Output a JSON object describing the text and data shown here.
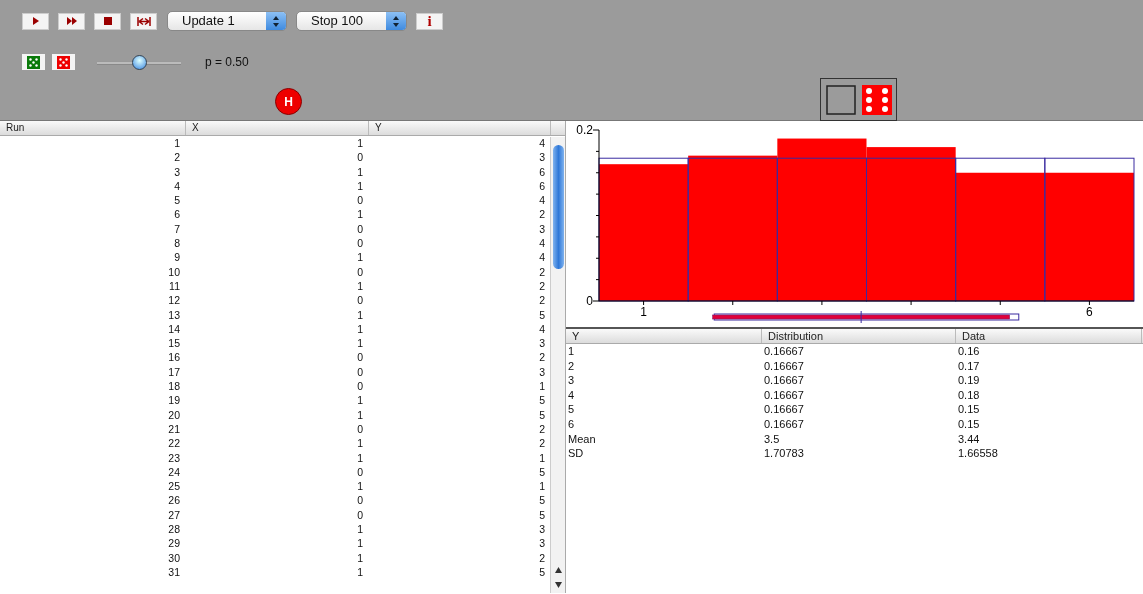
{
  "toolbar": {
    "update_select": {
      "value": "Update 1"
    },
    "stop_select": {
      "value": "Stop 100"
    },
    "info_button": "i"
  },
  "parameter": {
    "label": "p = 0.50",
    "level": 0.5
  },
  "result_badge": "H",
  "runs_table": {
    "columns": [
      "Run",
      "X",
      "Y"
    ],
    "rows": [
      [
        "1",
        "1",
        "4"
      ],
      [
        "2",
        "0",
        "3"
      ],
      [
        "3",
        "1",
        "6"
      ],
      [
        "4",
        "1",
        "6"
      ],
      [
        "5",
        "0",
        "4"
      ],
      [
        "6",
        "1",
        "2"
      ],
      [
        "7",
        "0",
        "3"
      ],
      [
        "8",
        "0",
        "4"
      ],
      [
        "9",
        "1",
        "4"
      ],
      [
        "10",
        "0",
        "2"
      ],
      [
        "11",
        "1",
        "2"
      ],
      [
        "12",
        "0",
        "2"
      ],
      [
        "13",
        "1",
        "5"
      ],
      [
        "14",
        "1",
        "4"
      ],
      [
        "15",
        "1",
        "3"
      ],
      [
        "16",
        "0",
        "2"
      ],
      [
        "17",
        "0",
        "3"
      ],
      [
        "18",
        "0",
        "1"
      ],
      [
        "19",
        "1",
        "5"
      ],
      [
        "20",
        "1",
        "5"
      ],
      [
        "21",
        "0",
        "2"
      ],
      [
        "22",
        "1",
        "2"
      ],
      [
        "23",
        "1",
        "1"
      ],
      [
        "24",
        "0",
        "5"
      ],
      [
        "25",
        "1",
        "1"
      ],
      [
        "26",
        "0",
        "5"
      ],
      [
        "27",
        "0",
        "5"
      ],
      [
        "28",
        "1",
        "3"
      ],
      [
        "29",
        "1",
        "3"
      ],
      [
        "30",
        "1",
        "2"
      ],
      [
        "31",
        "1",
        "5"
      ]
    ]
  },
  "distribution_chart": {
    "chart_data": {
      "type": "bar",
      "x": [
        1,
        2,
        3,
        4,
        5,
        6
      ],
      "series": [
        {
          "color": "#ff0000",
          "values": [
            0.16,
            0.17,
            0.19,
            0.18,
            0.15,
            0.15
          ]
        },
        {
          "color": "#3a2aa0",
          "values": [
            0.167,
            0.167,
            0.167,
            0.167,
            0.167,
            0.167
          ]
        }
      ],
      "xlim": [
        0.5,
        6.5
      ],
      "ylim": [
        0,
        0.2
      ],
      "yticks": [
        0,
        0.2
      ],
      "xticks": [
        1,
        6
      ]
    }
  },
  "stats_table": {
    "columns": [
      "Y",
      "Distribution",
      "Data"
    ],
    "rows": [
      [
        "1",
        "0.16667",
        "0.16"
      ],
      [
        "2",
        "0.16667",
        "0.17"
      ],
      [
        "3",
        "0.16667",
        "0.19"
      ],
      [
        "4",
        "0.16667",
        "0.18"
      ],
      [
        "5",
        "0.16667",
        "0.15"
      ],
      [
        "6",
        "0.16667",
        "0.15"
      ],
      [
        "Mean",
        "3.5",
        "3.44"
      ],
      [
        "SD",
        "1.70783",
        "1.66558"
      ]
    ]
  }
}
